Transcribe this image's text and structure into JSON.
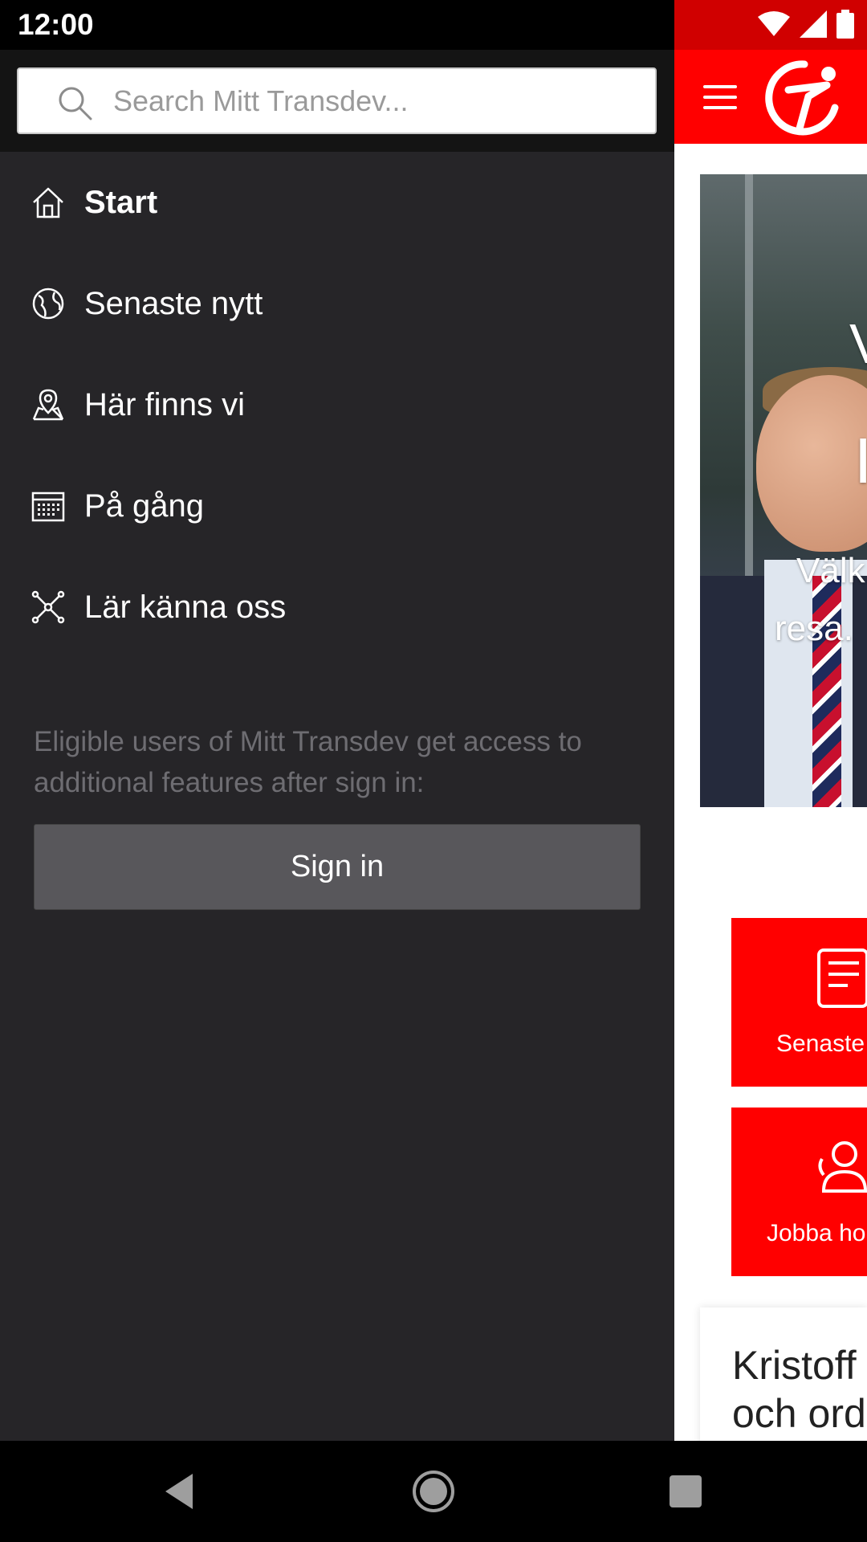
{
  "status_bar": {
    "time": "12:00",
    "icons": [
      "wifi-icon",
      "signal-icon",
      "battery-icon"
    ]
  },
  "search": {
    "placeholder": "Search Mitt Transdev..."
  },
  "nav": {
    "items": [
      {
        "label": "Start",
        "icon": "home-icon",
        "active": true
      },
      {
        "label": "Senaste nytt",
        "icon": "globe-icon",
        "active": false
      },
      {
        "label": "Här finns vi",
        "icon": "map-pin-icon",
        "active": false
      },
      {
        "label": "På gång",
        "icon": "calendar-icon",
        "active": false
      },
      {
        "label": "Lär känna oss",
        "icon": "network-icon",
        "active": false
      }
    ]
  },
  "signin": {
    "info": "Eligible users of Mitt Transdev get access to additional features after sign in:",
    "button_label": "Sign in"
  },
  "background_app": {
    "hero_lines": [
      "V",
      "I",
      "Välk",
      "resa."
    ],
    "tiles": [
      {
        "label": "Senaste",
        "icon": "newspaper-icon"
      },
      {
        "label": "Jobba ho",
        "icon": "people-icon"
      }
    ],
    "card_title": "Kristoff\noch ord"
  },
  "colors": {
    "brand_red": "#ff0000",
    "drawer_bg": "#262528",
    "signin_button": "#58575b"
  }
}
